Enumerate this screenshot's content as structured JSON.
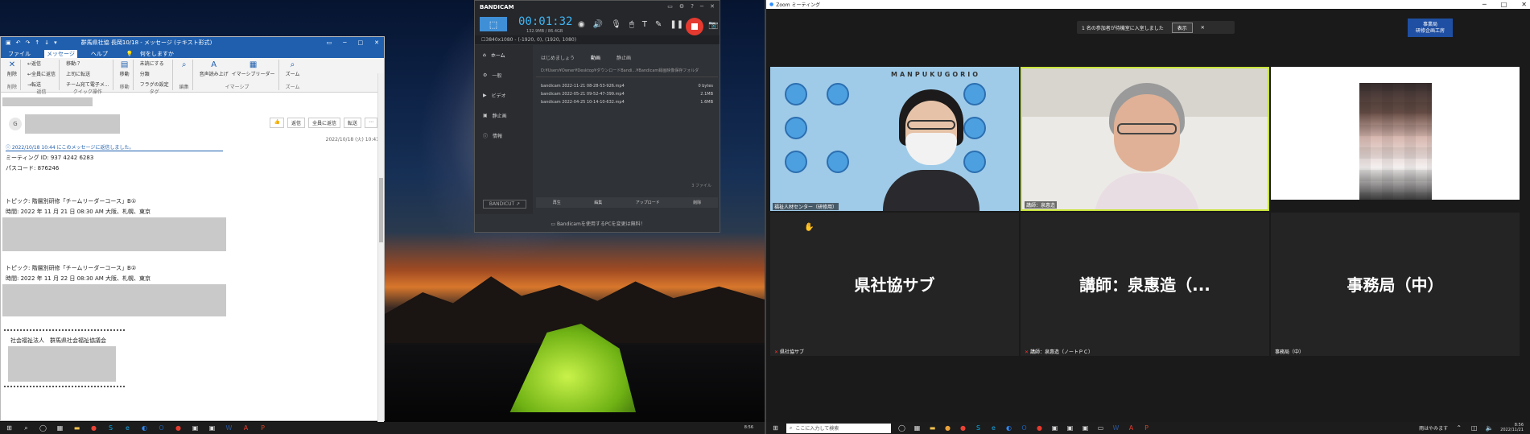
{
  "outlook": {
    "title": "群馬県社協 長岡10/18 - メッセージ (テキスト形式)",
    "tabs": [
      "ファイル",
      "メッセージ",
      "ヘルプ",
      "何をしますか"
    ],
    "ribbon_groups": [
      {
        "name": "削除",
        "items": [
          "削除"
        ]
      },
      {
        "name": "返信",
        "items": [
          "返信",
          "全員に返信",
          "転送"
        ]
      },
      {
        "name": "クイック操作",
        "items": [
          "移動:？",
          "上司に転送",
          "チーム宛て電子メ..."
        ]
      },
      {
        "name": "移動",
        "items": [
          "移動"
        ]
      },
      {
        "name": "タグ",
        "items": [
          "未読にする",
          "分類",
          "フラグの設定"
        ]
      },
      {
        "name": "編集",
        "items": [
          "編集"
        ]
      },
      {
        "name": "イマーシブ",
        "items": [
          "音声読み上げ",
          "イマーシブリーダー"
        ]
      },
      {
        "name": "ズーム",
        "items": [
          "ズーム"
        ]
      }
    ],
    "avatar_initial": "G",
    "reply_buttons": [
      "返信",
      "全員に返信",
      "転送"
    ],
    "sent_date": "2022/10/18 (火) 10:41",
    "info_line": "2022/10/18 10:44 にこのメッセージに返信しました。",
    "meeting_id": "ミーティング ID: 937 4242 6283",
    "passcode": "パスコード: 876246",
    "topic1": "トピック: 階層別研修「チームリーダーコース」B①",
    "time1": "時間: 2022 年 11 月 21 日 08:30 AM 大阪、札幌、東京",
    "topic2": "トピック: 階層別研修「チームリーダーコース」B②",
    "time2": "時間: 2022 年 11 月 22 日 08:30 AM 大阪、札幌、東京",
    "signature": "社会福祉法人　群馬県社会福祉協議会"
  },
  "bandicam": {
    "logo": "BANDICAM",
    "timer": "00:01:32",
    "size": "132.9MB / 86.4GB",
    "resolution": "3840x1080 - (-1920, 0), (1920, 1080)",
    "sidebar": [
      "ホーム",
      "一般",
      "ビデオ",
      "静止画",
      "情報"
    ],
    "tabs": [
      "はじめましょう",
      "動画",
      "静止画"
    ],
    "path": "D:¥Users¥Owner¥Desktop¥ダウンロードBandi...¥Bandicam録画映像保存フォルダ",
    "files": [
      {
        "name": "bandicam 2022-11-21 08-28-53-926.mp4",
        "size": "0 bytes"
      },
      {
        "name": "bandicam 2022-05-21 09-52-47-399.mp4",
        "size": "2.1MB"
      },
      {
        "name": "bandicam 2022-04-25 10-14-10-632.mp4",
        "size": "1.6MB"
      }
    ],
    "count": "3 ファイル",
    "actions": [
      "再生",
      "編集",
      "アップロード",
      "削除"
    ],
    "bandicut": "BANDICUT ↗",
    "footer": "Bandicamを使用するPCを変更は無料！"
  },
  "zoom": {
    "title": "Zoom ミーティング",
    "notice": "1 名の参加者が待機室に入室しました",
    "notice_button": "表示",
    "badge_line1": "事業局",
    "badge_line2": "研修企画工房",
    "brand_text": "MANPUKUGORIO",
    "video_tiles": [
      "福祉人材センター（研修用）",
      "講師：泉惠造",
      ""
    ],
    "name_tiles": [
      {
        "big": "県社協サブ",
        "label": "県社協サブ"
      },
      {
        "big": "講師：泉惠造（...",
        "label": "講師：泉惠造（ノートＰＣ）"
      },
      {
        "big": "事務局（中）",
        "label": "事務局（中）"
      }
    ]
  },
  "taskbar": {
    "search_placeholder": "ここに入力して検索",
    "weather": "雨はやみます",
    "time_left": "8:56",
    "time_right": "8:56",
    "date_right": "2022/11/21"
  },
  "colors": {
    "outlook_blue": "#1f5fae",
    "bandicam_timer": "#3fb6f5",
    "rec_red": "#e53a2f",
    "zoom_active_border": "#c9e43a"
  }
}
